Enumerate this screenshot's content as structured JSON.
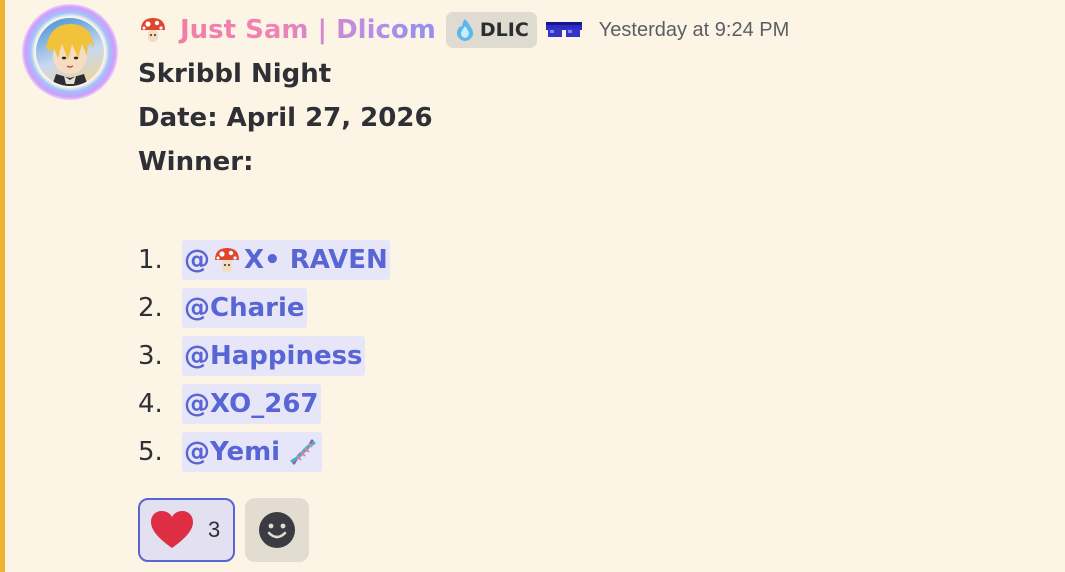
{
  "message": {
    "author": {
      "display_name": "Just Sam | Dlicom",
      "name_icon": "mushroom-emoji",
      "tag": "DLIC",
      "tag_icon": "blue-flame-icon",
      "badge_icon": "pixel-sunglasses-icon"
    },
    "timestamp": "Yesterday at 9:24 PM",
    "lines": {
      "title": "Skribbl Night",
      "date": "Date: April 27, 2026",
      "winner_label": "Winner:"
    },
    "winners": [
      {
        "rank": "1.",
        "mention": "@",
        "icon": "mushroom-emoji",
        "name": "X• RAVEN"
      },
      {
        "rank": "2.",
        "mention": "@Charie"
      },
      {
        "rank": "3.",
        "mention": "@Happiness"
      },
      {
        "rank": "4.",
        "mention": "@XO_267"
      },
      {
        "rank": "5.",
        "mention": "@Yemi",
        "icon_after": "dna-emoji"
      }
    ],
    "reactions": [
      {
        "emoji": "red-heart-emoji",
        "count": "3",
        "selected": true
      },
      {
        "emoji": "add-reaction-icon"
      }
    ]
  },
  "colors": {
    "highlight_bar": "#f0b232",
    "background": "#fcf5e6",
    "mention_text": "#5865d4",
    "mention_bg": "#e6e6f8",
    "username_gradient": [
      "#f57aa4",
      "#8e8ff0"
    ]
  }
}
